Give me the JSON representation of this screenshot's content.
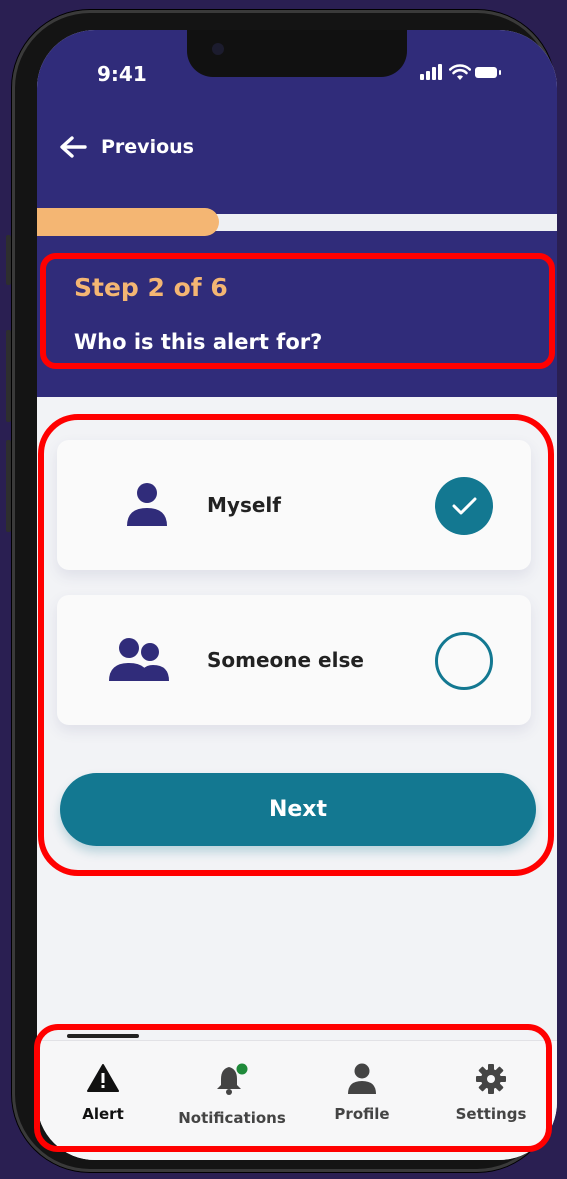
{
  "status_bar": {
    "time": "9:41"
  },
  "header": {
    "back_label": "Previous",
    "progress": 0.35,
    "step_label": "Step 2 of 6",
    "question": "Who is this alert for?"
  },
  "options": [
    {
      "label": "Myself",
      "icon": "person-icon",
      "selected": true
    },
    {
      "label": "Someone else",
      "icon": "people-icon",
      "selected": false
    }
  ],
  "next_label": "Next",
  "tabs": [
    {
      "label": "Alert",
      "icon": "warning-icon",
      "active": true
    },
    {
      "label": "Notifications",
      "icon": "bell-icon",
      "active": false
    },
    {
      "label": "Profile",
      "icon": "person-icon",
      "active": false
    },
    {
      "label": "Settings",
      "icon": "gear-icon",
      "active": false
    }
  ],
  "colors": {
    "header_bg": "#302c7a",
    "accent_orange": "#f4b673",
    "teal": "#137891",
    "highlight": "#ff0000",
    "notification_dot": "#1f8a3a"
  }
}
